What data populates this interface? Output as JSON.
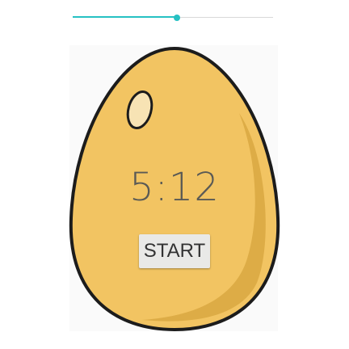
{
  "slider": {
    "value_fraction": 0.52,
    "accent_color": "#26c1c3"
  },
  "egg": {
    "fill_color": "#f2c462",
    "shadow_color": "#ddac46",
    "outline_color": "#1c1c1c",
    "highlight_color": "#f7e3b4"
  },
  "timer": {
    "display": "5:12"
  },
  "start_button": {
    "label": "START"
  }
}
